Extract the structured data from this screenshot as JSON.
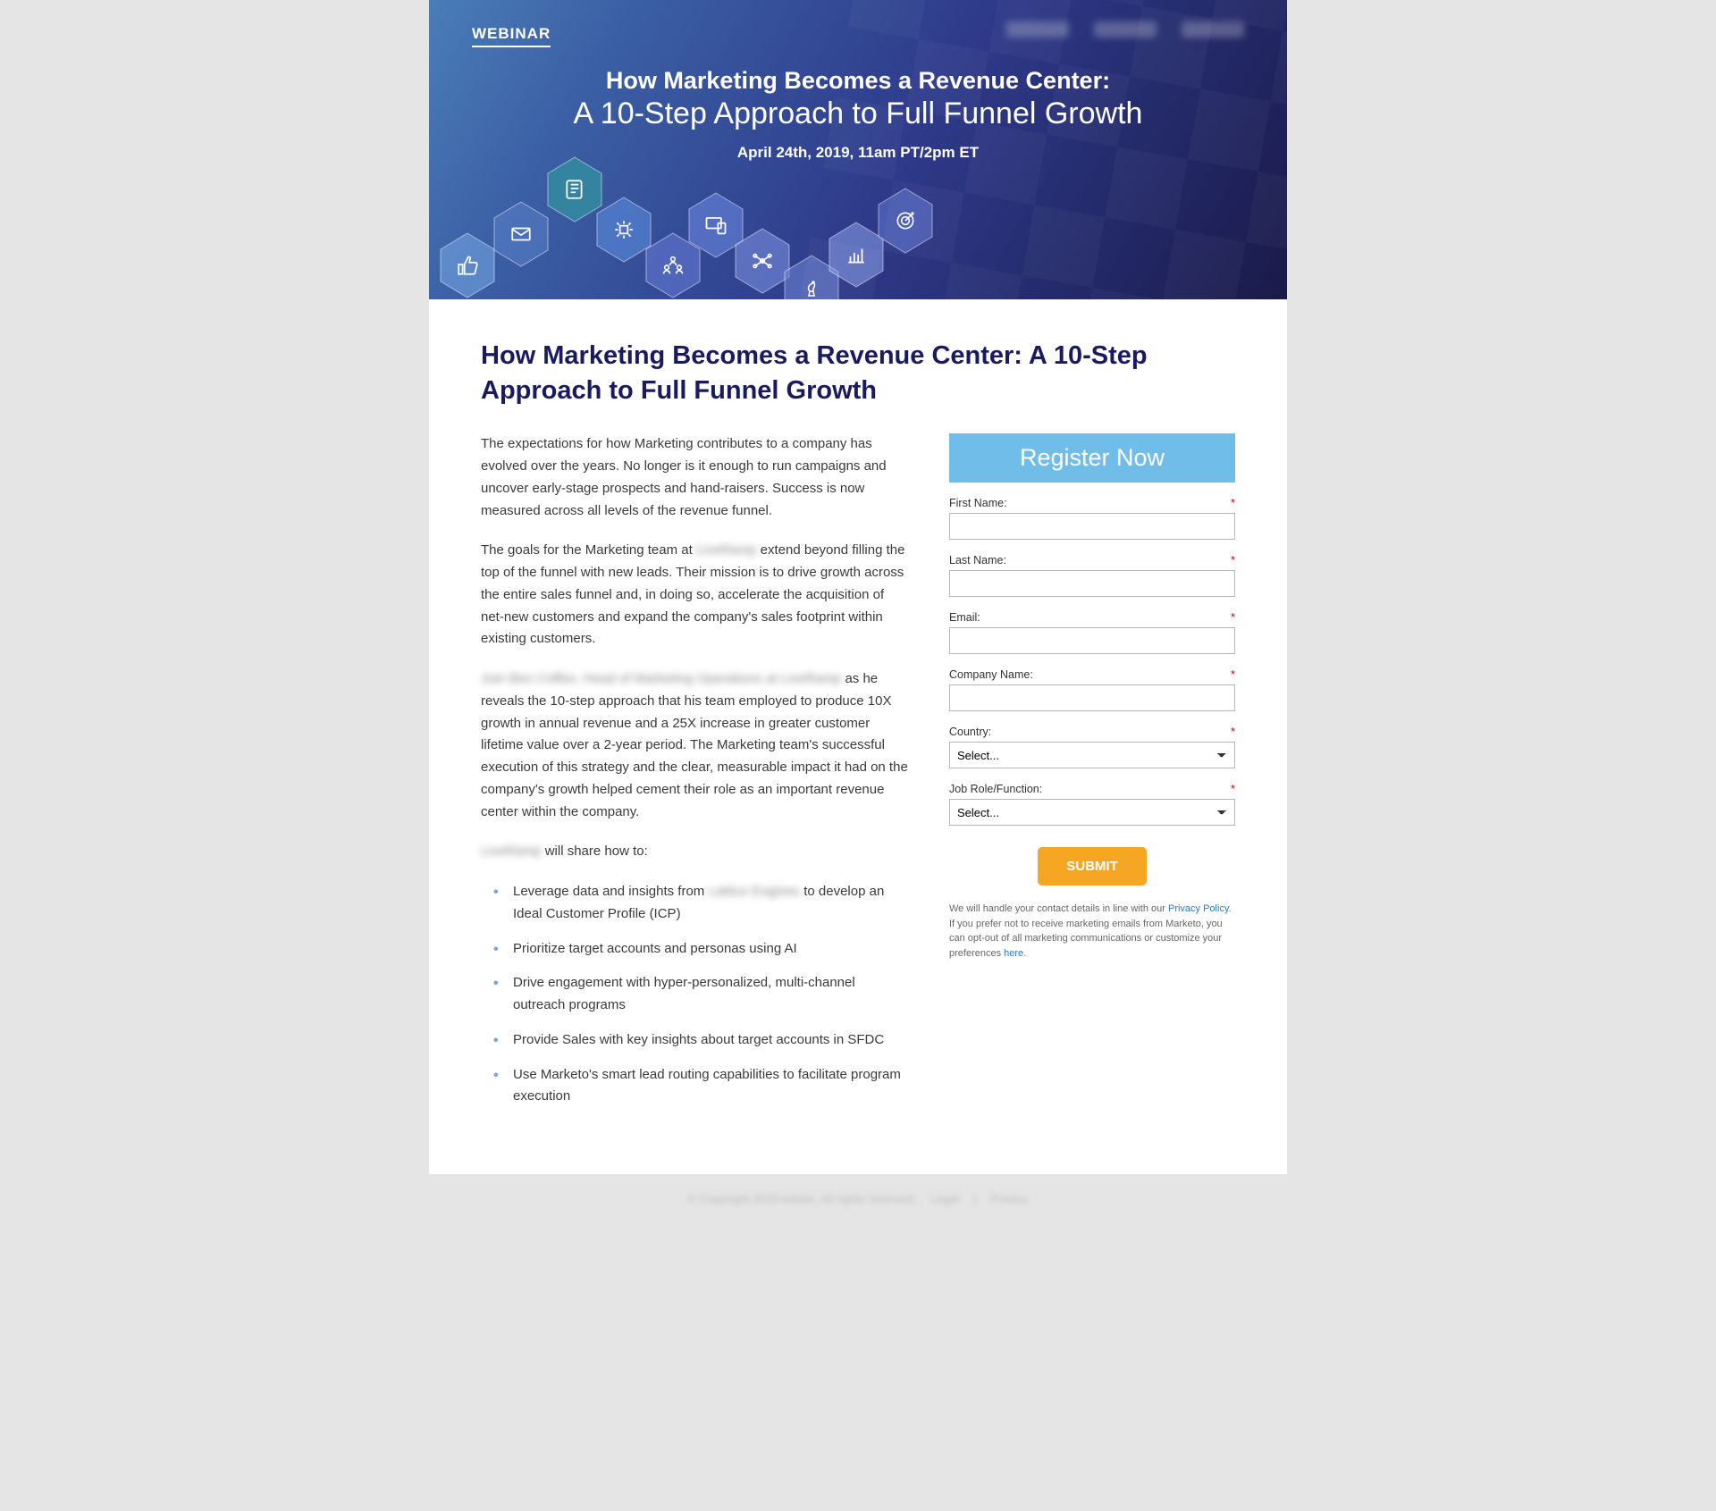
{
  "hero": {
    "tag": "WEBINAR",
    "title_line1": "How Marketing Becomes a Revenue Center:",
    "title_line2": "A 10-Step Approach to Full Funnel Growth",
    "date": "April 24th, 2019, 11am PT/2pm ET"
  },
  "content": {
    "heading": "How Marketing Becomes a Revenue Center: A 10-Step Approach to Full Funnel Growth",
    "p1": "The expectations for how Marketing contributes to a company has evolved over the years. No longer is it enough to run campaigns and uncover early-stage prospects and hand-raisers. Success is now measured across all levels of the revenue funnel.",
    "p2_pre": "The goals for the Marketing team at ",
    "p2_blur": "LiveRamp",
    "p2_post": " extend beyond filling the top of the funnel with new leads. Their mission is to drive growth across the entire sales funnel and, in doing so, accelerate the acquisition of net-new customers and expand the company's sales footprint within existing customers.",
    "p3_blur": "Join Ben Coffee, Head of Marketing Operations at LiveRamp",
    "p3_post": " as he reveals the 10-step approach that his team employed to produce 10X growth in annual revenue and a 25X increase in greater customer lifetime value over a 2-year period. The Marketing team's successful execution of this strategy and the clear, measurable impact it had on the company's growth helped cement their role as an important revenue center within the company.",
    "p4_blur": "LiveRamp",
    "p4_post": " will share how to:",
    "bullets": [
      {
        "pre": "Leverage data and insights from ",
        "blur": "Lattice Engines",
        "post": " to develop an Ideal Customer Profile (ICP)"
      },
      {
        "text": "Prioritize target accounts and personas using AI"
      },
      {
        "text": "Drive engagement with hyper-personalized, multi-channel outreach programs"
      },
      {
        "text": "Provide Sales with key insights about target accounts in SFDC"
      },
      {
        "text": "Use Marketo's smart lead routing capabilities to facilitate program execution"
      }
    ]
  },
  "form": {
    "header": "Register Now",
    "fields": {
      "first_name": "First Name:",
      "last_name": "Last Name:",
      "email": "Email:",
      "company": "Company Name:",
      "country": "Country:",
      "job_role": "Job Role/Function:"
    },
    "select_placeholder": "Select...",
    "submit": "SUBMIT",
    "disclaimer_pre": "We will handle your contact details in line with our ",
    "disclaimer_link1": "Privacy Policy",
    "disclaimer_mid": ". If you prefer not to receive marketing emails from Marketo, you can opt-out of all marketing communications or customize your preferences ",
    "disclaimer_link2": "here",
    "disclaimer_post": "."
  },
  "footer": {
    "copyright": "© Copyright 2019 Adobe. All rights reserved.",
    "legal": "Legal",
    "privacy": "Privacy"
  },
  "colors": {
    "accent_blue": "#6fbde8",
    "submit_orange": "#f5a623",
    "heading_navy": "#1a1a5e"
  }
}
